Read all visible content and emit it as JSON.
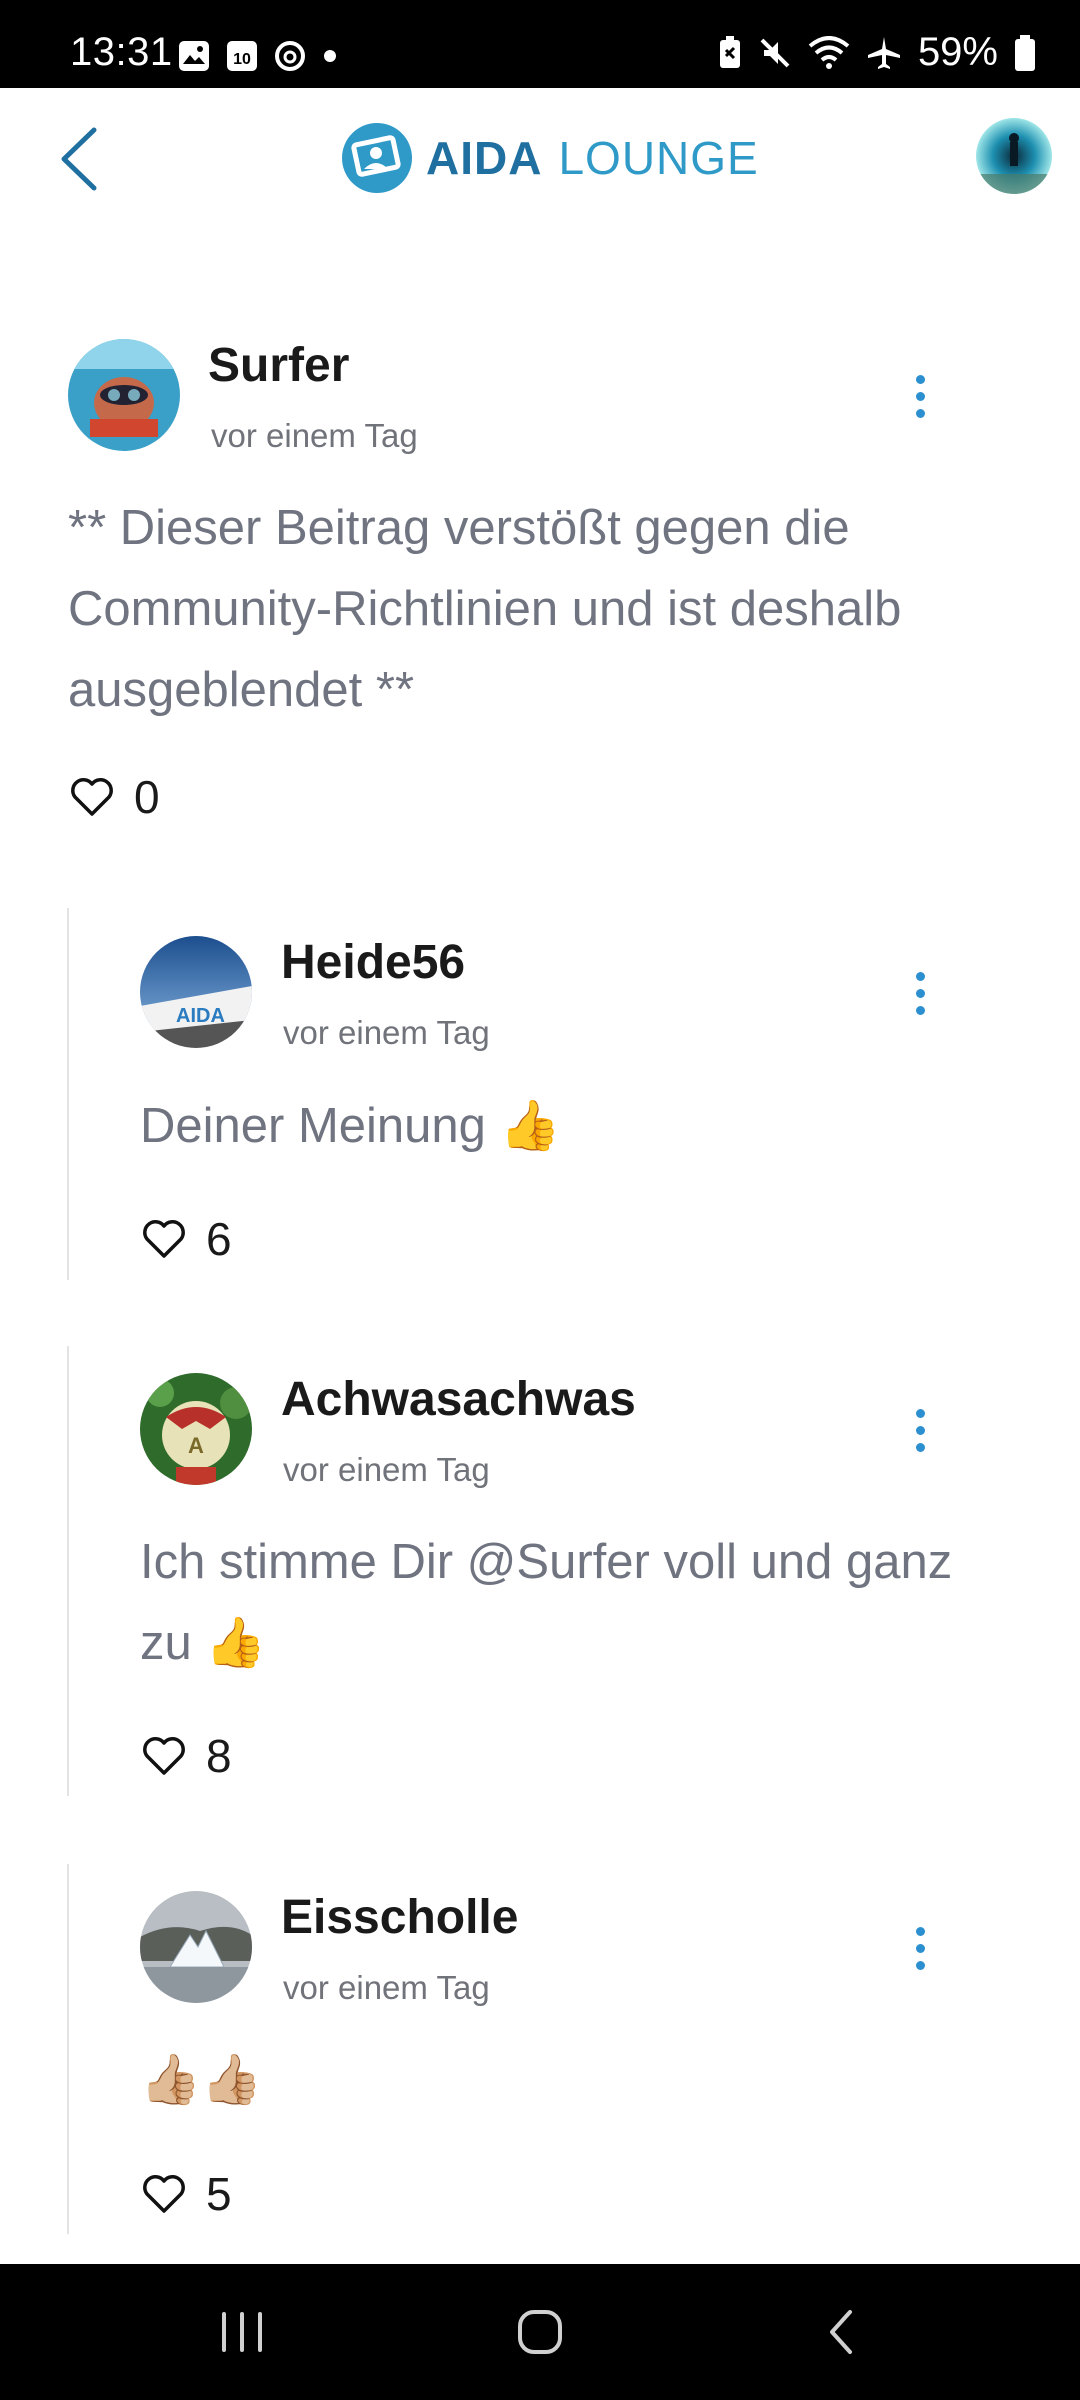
{
  "status_bar": {
    "time": "13:31",
    "battery_percent": "59%",
    "icons": [
      "gallery-icon",
      "calendar-icon",
      "threads-icon",
      "dot-icon",
      "battery-saver-icon",
      "mute-icon",
      "wifi-icon",
      "airplane-icon",
      "battery-icon"
    ]
  },
  "header": {
    "logo_bold": "AIDA",
    "logo_light": "LOUNGE",
    "colors": {
      "brand_dark": "#1f6fa0",
      "brand_light": "#2f9ac8"
    }
  },
  "posts": [
    {
      "username": "Surfer",
      "time": "vor einem Tag",
      "text_lines": [
        "** Dieser Beitrag verstößt gegen die",
        "Community-Richtlinien und ist deshalb",
        "ausgeblendet **"
      ],
      "likes": "0"
    },
    {
      "username": "Heide56",
      "time": "vor einem Tag",
      "text_lines": [
        "Deiner Meinung 👍"
      ],
      "likes": "6"
    },
    {
      "username": "Achwasachwas",
      "time": "vor einem Tag",
      "text_lines": [
        "Ich stimme Dir @Surfer voll und ganz",
        "zu 👍"
      ],
      "likes": "8"
    },
    {
      "username": "Eisscholle",
      "time": "vor einem Tag",
      "text_lines": [
        "👍🏼👍🏼"
      ],
      "likes": "5"
    }
  ],
  "nav_bar": {
    "buttons": [
      "recent-apps",
      "home",
      "back"
    ]
  }
}
